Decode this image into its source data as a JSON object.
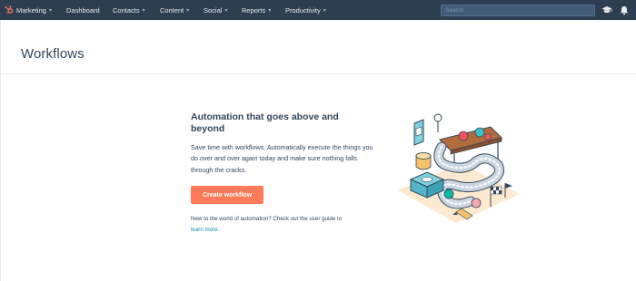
{
  "nav": {
    "items": [
      {
        "label": "Marketing",
        "has_caret": true
      },
      {
        "label": "Dashboard",
        "has_caret": false
      },
      {
        "label": "Contacts",
        "has_caret": true
      },
      {
        "label": "Content",
        "has_caret": true
      },
      {
        "label": "Social",
        "has_caret": true
      },
      {
        "label": "Reports",
        "has_caret": true
      },
      {
        "label": "Productivity",
        "has_caret": true
      }
    ],
    "search_placeholder": "Search",
    "icons": [
      "academy-icon",
      "notifications-bell-icon"
    ],
    "background_color": "#2d3e50"
  },
  "page": {
    "title": "Workflows"
  },
  "empty_state": {
    "headline": "Automation that goes above and beyond",
    "description": "Save time with workflows. Automatically execute the things you do over and over again today and make sure nothing falls through the cracks.",
    "cta_label": "Create workflow",
    "cta_color": "#ff7a59",
    "footnote": "New to the world of automation? Check out the user guide to",
    "link_text": "learn more."
  },
  "colors": {
    "link": "#0091ae",
    "text": "#33475b"
  }
}
